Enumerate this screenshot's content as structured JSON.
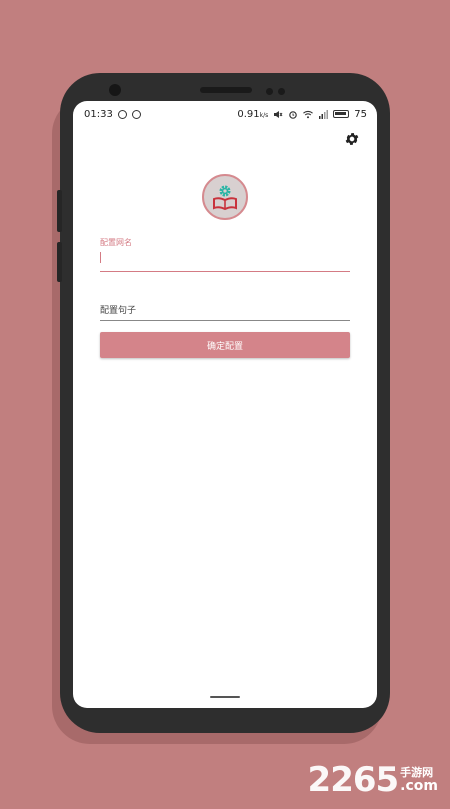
{
  "status_bar": {
    "time": "01:33",
    "network_speed": "0.91",
    "network_unit": "k/s",
    "battery": "75"
  },
  "form": {
    "name_label": "配置网名",
    "name_value": "",
    "sentence_placeholder": "配置句子",
    "confirm_label": "确定配置"
  },
  "icons": {
    "settings": "gear-icon",
    "logo": "gear-book-logo-icon"
  },
  "colors": {
    "background": "#c17f7f",
    "accent": "#d4848a",
    "logo_teal": "#2ab5a5",
    "logo_red": "#c8323c"
  },
  "watermark": {
    "number": "2265",
    "cn": "手游网",
    "domain": ".com"
  }
}
